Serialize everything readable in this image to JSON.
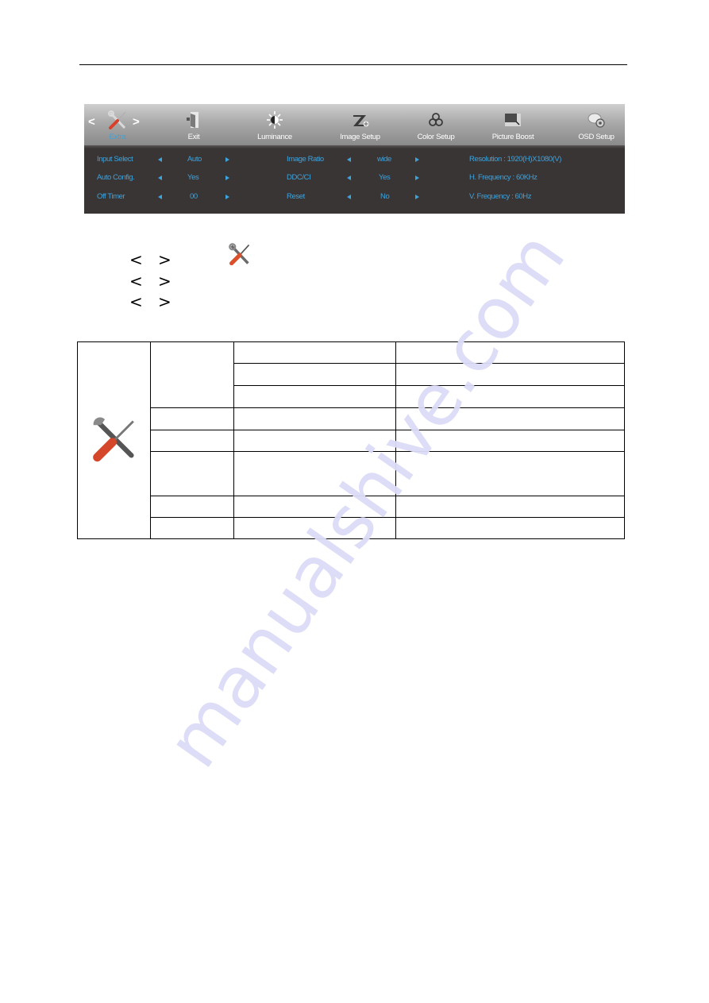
{
  "osd_menu": {
    "nav_prev": "<",
    "nav_next": ">",
    "tabs": [
      {
        "label": "Extra",
        "icon": "tools-icon",
        "selected": true
      },
      {
        "label": "Exit",
        "icon": "exit-door-icon",
        "selected": false
      },
      {
        "label": "Luminance",
        "icon": "sun-icon",
        "selected": false
      },
      {
        "label": "Image Setup",
        "icon": "image-setup-icon",
        "selected": false
      },
      {
        "label": "Color Setup",
        "icon": "color-circles-icon",
        "selected": false
      },
      {
        "label": "Picture Boost",
        "icon": "picture-boost-icon",
        "selected": false
      },
      {
        "label": "OSD Setup",
        "icon": "osd-setup-icon",
        "selected": false
      }
    ],
    "settings_left": [
      {
        "label": "Input Select",
        "value": "Auto"
      },
      {
        "label": "Auto Config.",
        "value": "Yes"
      },
      {
        "label": "Off Timer",
        "value": "00"
      }
    ],
    "settings_middle": [
      {
        "label": "Image Ratio",
        "value": "wide"
      },
      {
        "label": "DDC/CI",
        "value": "Yes"
      },
      {
        "label": "Reset",
        "value": "No"
      }
    ],
    "info": [
      "Resolution : 1920(H)X1080(V)",
      "H. Frequency : 60KHz",
      "V. Frequency : 60Hz"
    ],
    "colors": {
      "accent": "#3da3dc",
      "panel": "#3a3535",
      "tab_bar": "#a9a9a9"
    }
  },
  "instructions": {
    "chevron_left": "<",
    "chevron_right": ">",
    "lines": 3,
    "inline_icon": "tools-icon"
  },
  "reference_table": {
    "icon": "tools-icon",
    "rows": 8
  },
  "watermark": "manualshive.com"
}
